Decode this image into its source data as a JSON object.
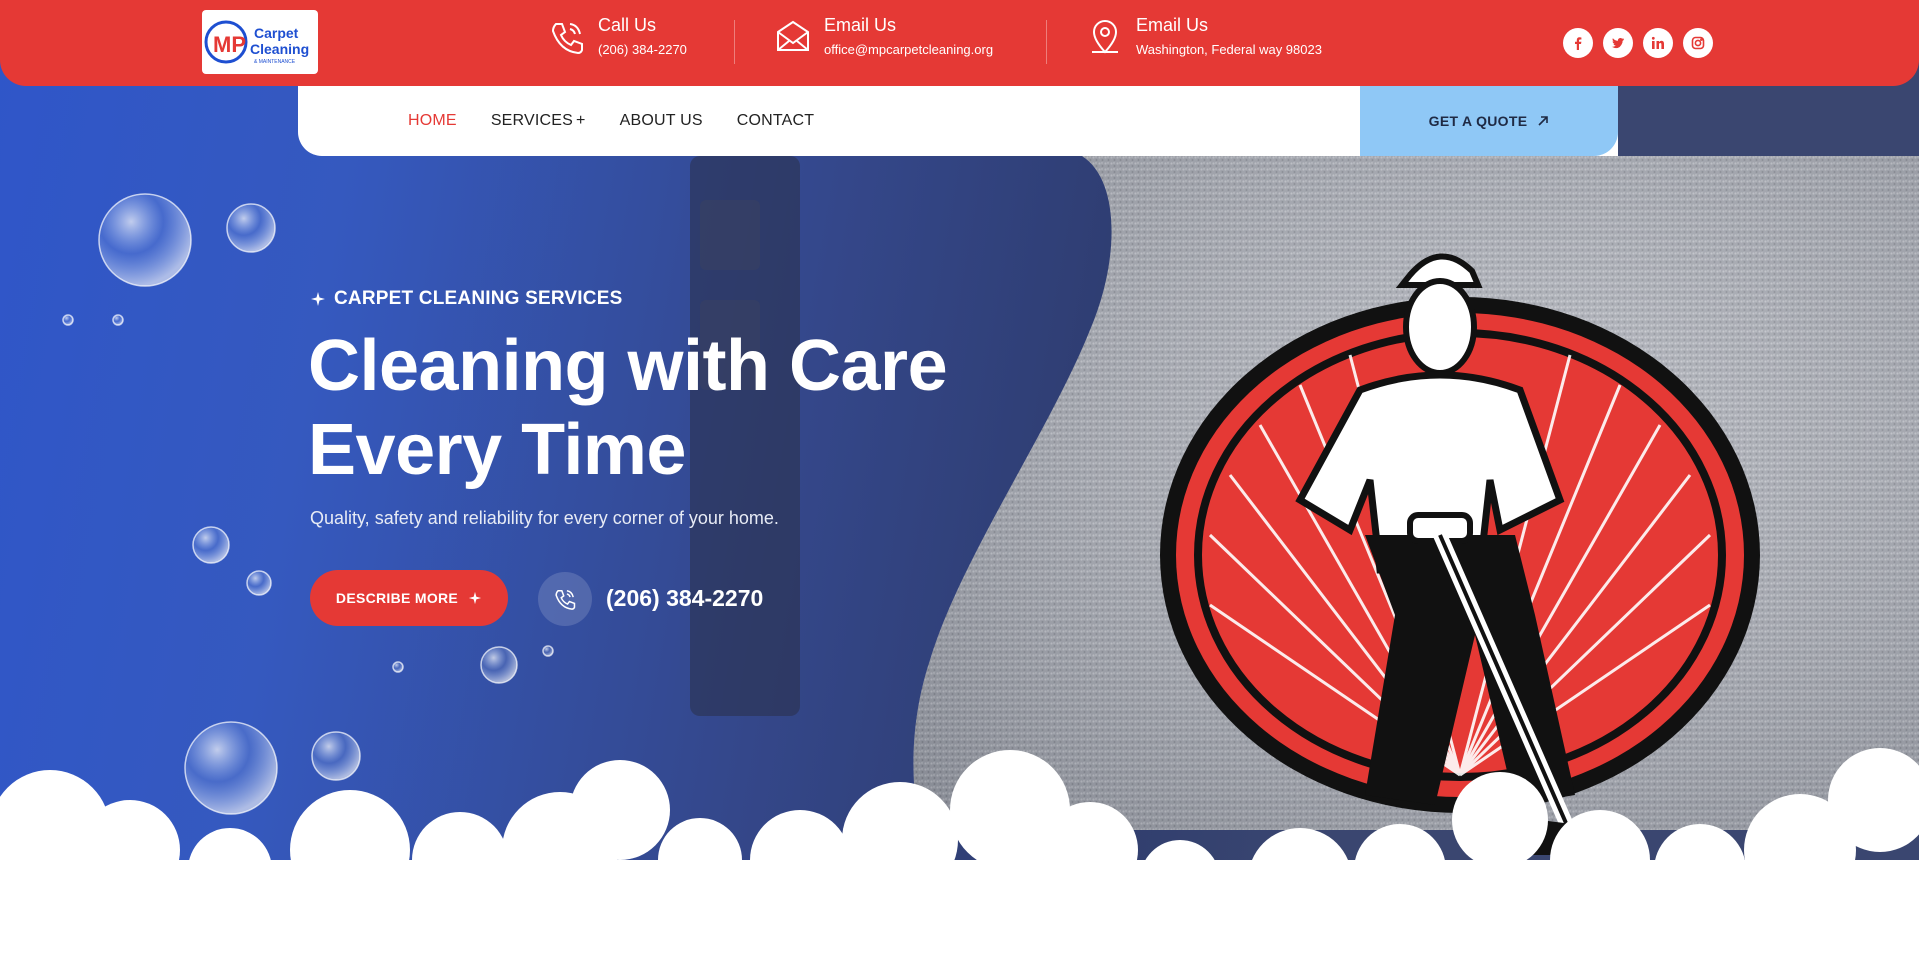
{
  "logo": {
    "letters": "MP",
    "line1": "Carpet",
    "line2": "Cleaning",
    "line3": "& MAINTENANCE"
  },
  "contact": {
    "call": {
      "title": "Call Us",
      "value": "(206) 384-2270",
      "icon": "phone-icon"
    },
    "email": {
      "title": "Email Us",
      "value": "office@mpcarpetcleaning.org",
      "icon": "envelope-icon"
    },
    "location": {
      "title": "Email Us",
      "value": "Washington, Federal way 98023",
      "icon": "map-pin-icon"
    }
  },
  "social": [
    "facebook-icon",
    "twitter-icon",
    "linkedin-icon",
    "instagram-icon"
  ],
  "nav": {
    "items": [
      {
        "label": "HOME",
        "active": true
      },
      {
        "label": "SERVICES",
        "suffix": "+"
      },
      {
        "label": "ABOUT US"
      },
      {
        "label": "CONTACT"
      }
    ],
    "quote_label": "GET A QUOTE"
  },
  "hero": {
    "eyebrow": "CARPET CLEANING SERVICES",
    "headline_line1": "Cleaning with Care",
    "headline_line2": "Every Time",
    "subtitle": "Quality, safety and reliability for every corner of your home.",
    "cta_label": "DESCRIBE MORE",
    "phone": "(206) 384-2270"
  },
  "colors": {
    "brand_red": "#e53935",
    "accent_blue": "#8fc8f6",
    "hero_blue": "#2f56c9",
    "text_dark": "#222222"
  }
}
